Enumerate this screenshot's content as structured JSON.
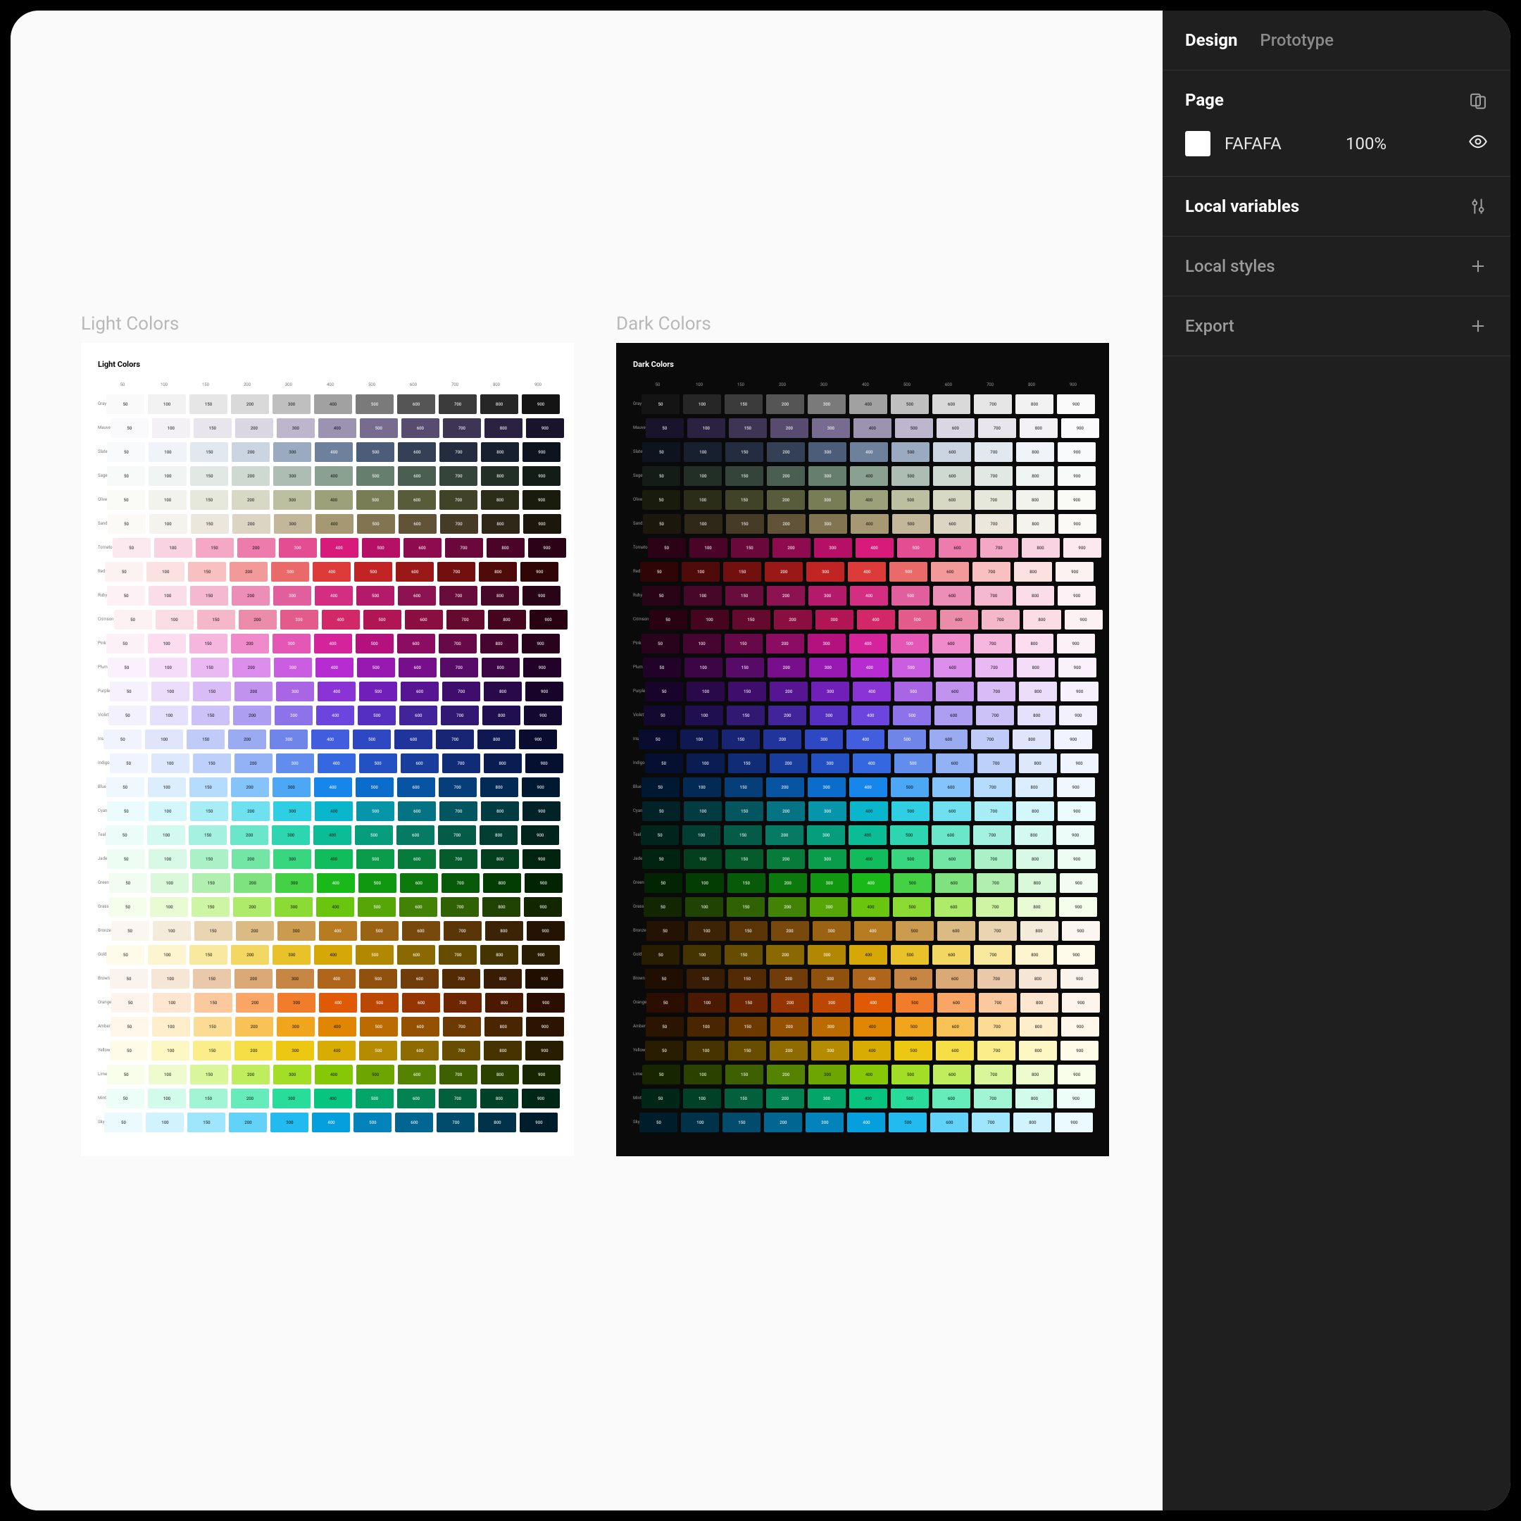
{
  "tabs": {
    "design": "Design",
    "prototype": "Prototype"
  },
  "page": {
    "label": "Page",
    "fill_hex": "FAFAFA",
    "fill_opacity": "100%"
  },
  "sections": {
    "local_variables": "Local variables",
    "local_styles": "Local styles",
    "export": "Export"
  },
  "canvas": {
    "light_frame_label": "Light Colors",
    "dark_frame_label": "Dark Colors",
    "light_title": "Light Colors",
    "dark_title": "Dark Colors",
    "steps": [
      "50",
      "100",
      "150",
      "200",
      "300",
      "400",
      "500",
      "600",
      "700",
      "800",
      "900"
    ],
    "families": [
      {
        "name": "Gray",
        "colors": [
          "#FAFAFA",
          "#F2F2F2",
          "#E6E6E6",
          "#D9D9D9",
          "#BFBFBF",
          "#A1A1A1",
          "#7A7A7A",
          "#555555",
          "#3B3B3B",
          "#262626",
          "#141414"
        ]
      },
      {
        "name": "Mauve",
        "colors": [
          "#FAF9FB",
          "#F3F1F6",
          "#E8E5ED",
          "#DAD6E3",
          "#BDB6CC",
          "#9C93B1",
          "#776C90",
          "#574C70",
          "#3E3554",
          "#2A2240",
          "#19132B"
        ]
      },
      {
        "name": "Slate",
        "colors": [
          "#F8FAFC",
          "#F0F4F8",
          "#E2E8F0",
          "#CBD5E1",
          "#9AAAC0",
          "#6E819C",
          "#4B5D78",
          "#334056",
          "#232D3F",
          "#17202E",
          "#0D1420"
        ]
      },
      {
        "name": "Sage",
        "colors": [
          "#F8FAF9",
          "#F0F4F2",
          "#E2E9E5",
          "#CED9D2",
          "#AEBDB3",
          "#8AA091",
          "#667E6E",
          "#4A5E51",
          "#34443A",
          "#222F27",
          "#131C17"
        ]
      },
      {
        "name": "Olive",
        "colors": [
          "#FAFAF7",
          "#F3F3ED",
          "#E7E8DC",
          "#D7D9C5",
          "#BCC0A1",
          "#9CA17A",
          "#787D56",
          "#585C3B",
          "#404328",
          "#2B2D19",
          "#191B0D"
        ]
      },
      {
        "name": "Sand",
        "colors": [
          "#FBFAF7",
          "#F5F3ED",
          "#EBE7DC",
          "#DCD5C4",
          "#C2B79B",
          "#A69872",
          "#827450",
          "#605338",
          "#463B26",
          "#2F2718",
          "#1C170C"
        ]
      },
      {
        "name": "Tomato",
        "colors": [
          "#FCE9EF",
          "#F9D3E1",
          "#F4A8C6",
          "#ED7BAB",
          "#E44D92",
          "#D81B7A",
          "#B51066",
          "#8F0B50",
          "#6A073B",
          "#490428",
          "#2C0217"
        ]
      },
      {
        "name": "Red",
        "colors": [
          "#FDF2F2",
          "#FCE1E1",
          "#F8C0C0",
          "#F29A9A",
          "#EA6A6A",
          "#DD3A3A",
          "#C22323",
          "#9A1818",
          "#721010",
          "#4F0A0A",
          "#2F0505"
        ]
      },
      {
        "name": "Ruby",
        "colors": [
          "#FDF1F5",
          "#FADDE8",
          "#F4B9D1",
          "#EC8EB7",
          "#E25F9D",
          "#D32E82",
          "#B31A69",
          "#8D1252",
          "#680C3C",
          "#470728",
          "#290416"
        ]
      },
      {
        "name": "Crimson",
        "colors": [
          "#FDF1F4",
          "#FADDE5",
          "#F4B8CA",
          "#EC8CAB",
          "#E25B8A",
          "#D22868",
          "#B21553",
          "#8B0E40",
          "#66092E",
          "#45051E",
          "#280211"
        ]
      },
      {
        "name": "Pink",
        "colors": [
          "#FDF1F8",
          "#FBDDEF",
          "#F6B7DE",
          "#EF8ACB",
          "#E557B4",
          "#D5249B",
          "#B4117F",
          "#8D0C63",
          "#670848",
          "#460430",
          "#29021B"
        ]
      },
      {
        "name": "Plum",
        "colors": [
          "#FBF1FD",
          "#F5DDFA",
          "#EAB9F4",
          "#DC8EEC",
          "#CB5DE1",
          "#B62CD1",
          "#9818B2",
          "#770F8C",
          "#570A67",
          "#3B0546",
          "#220229"
        ]
      },
      {
        "name": "Purple",
        "colors": [
          "#F7F1FD",
          "#ECDDFA",
          "#D9BBF5",
          "#C293EE",
          "#A865E4",
          "#8B34D6",
          "#7020B8",
          "#561592",
          "#3F0E6C",
          "#2A094A",
          "#18042B"
        ]
      },
      {
        "name": "Violet",
        "colors": [
          "#F3F1FE",
          "#E5E0FC",
          "#CCC2F8",
          "#AE9EF2",
          "#8D73EA",
          "#6B45DD",
          "#5530C0",
          "#41239A",
          "#301873",
          "#200F50",
          "#120830"
        ]
      },
      {
        "name": "Iris",
        "colors": [
          "#F1F3FE",
          "#E0E5FC",
          "#C1CBF8",
          "#9BABF2",
          "#6F85EA",
          "#425EDE",
          "#2E47C2",
          "#21349B",
          "#172574",
          "#0F1850",
          "#080D30"
        ]
      },
      {
        "name": "Indigo",
        "colors": [
          "#F0F4FE",
          "#DEE8FD",
          "#BDD0FA",
          "#93B2F5",
          "#628DED",
          "#3567E0",
          "#2351C4",
          "#183D9D",
          "#102C76",
          "#0A1D52",
          "#051031"
        ]
      },
      {
        "name": "Blue",
        "colors": [
          "#EFF7FF",
          "#DBEEFE",
          "#B6DCFD",
          "#84C4FA",
          "#4CA7F5",
          "#1786EA",
          "#0A6CCB",
          "#0754A2",
          "#053E79",
          "#032A54",
          "#011832"
        ]
      },
      {
        "name": "Cyan",
        "colors": [
          "#ECFCFE",
          "#D4F7FB",
          "#A7EDF6",
          "#6EE0EF",
          "#2FCEE2",
          "#0AB6CB",
          "#0695A9",
          "#047485",
          "#035660",
          "#023B42",
          "#012226"
        ]
      },
      {
        "name": "Teal",
        "colors": [
          "#ECFDF9",
          "#D3F9F0",
          "#A4F1DF",
          "#6AE6CA",
          "#2DD6B0",
          "#0ABD96",
          "#069D7D",
          "#047B62",
          "#035B48",
          "#023E31",
          "#01241C"
        ]
      },
      {
        "name": "Jade",
        "colors": [
          "#EEFDF4",
          "#D7F9E5",
          "#AAF1C8",
          "#73E6A5",
          "#38D67F",
          "#10BC5C",
          "#0A9C4B",
          "#077B3A",
          "#055B2B",
          "#033E1D",
          "#012410"
        ]
      },
      {
        "name": "Green",
        "colors": [
          "#F0FDF0",
          "#DAF8DA",
          "#B1EFB1",
          "#7EE27E",
          "#45D145",
          "#1AB91A",
          "#109910",
          "#0B790B",
          "#075A07",
          "#043D04",
          "#022402"
        ]
      },
      {
        "name": "Grass",
        "colors": [
          "#F5FEEB",
          "#E8FBD2",
          "#CEF5A3",
          "#AEEB6B",
          "#8ADC34",
          "#6AC50F",
          "#56A608",
          "#428305",
          "#306103",
          "#204202",
          "#122601"
        ]
      },
      {
        "name": "Bronze",
        "colors": [
          "#FBF6EF",
          "#F5EBDB",
          "#EAD5B3",
          "#DCBA83",
          "#CB9B50",
          "#B77B22",
          "#996313",
          "#78490C",
          "#593508",
          "#3D2305",
          "#241302"
        ]
      },
      {
        "name": "Gold",
        "colors": [
          "#FEFBEB",
          "#FCF5D0",
          "#F8E99E",
          "#F2D863",
          "#E9C22A",
          "#D5A707",
          "#B28803",
          "#8B6902",
          "#664C01",
          "#453301",
          "#281D00"
        ]
      },
      {
        "name": "Brown",
        "colors": [
          "#FBF4ED",
          "#F5E6D6",
          "#E9C9A9",
          "#DAA976",
          "#C78644",
          "#AF651A",
          "#90500E",
          "#703C09",
          "#522B05",
          "#381C03",
          "#200F01"
        ]
      },
      {
        "name": "Orange",
        "colors": [
          "#FFF4EB",
          "#FEE6D1",
          "#FCC99F",
          "#F8A565",
          "#F17D2C",
          "#E05A06",
          "#BC4703",
          "#943502",
          "#6D2601",
          "#4A1900",
          "#2B0E00"
        ]
      },
      {
        "name": "Amber",
        "colors": [
          "#FFF8EA",
          "#FEEECC",
          "#FCDB95",
          "#F8C256",
          "#F1A51C",
          "#E08603",
          "#BC6B01",
          "#935101",
          "#6C3A00",
          "#492600",
          "#2B1500"
        ]
      },
      {
        "name": "Yellow",
        "colors": [
          "#FEFCE8",
          "#FDF7C4",
          "#FBED89",
          "#F6DE47",
          "#EDC812",
          "#D8AC02",
          "#B58C01",
          "#8E6B01",
          "#684D00",
          "#473300",
          "#291D00"
        ]
      },
      {
        "name": "Lime",
        "colors": [
          "#F8FEEA",
          "#EEFBCE",
          "#DAF69A",
          "#C0ED5E",
          "#A2DE25",
          "#86C706",
          "#6DA603",
          "#548302",
          "#3E6001",
          "#2A4100",
          "#182600"
        ]
      },
      {
        "name": "Mint",
        "colors": [
          "#ECFEF7",
          "#D2FBEB",
          "#A1F5D5",
          "#66ECBA",
          "#28DD9A",
          "#07C57E",
          "#04A568",
          "#038252",
          "#02603C",
          "#014128",
          "#002617"
        ]
      },
      {
        "name": "Sky",
        "colors": [
          "#EBFAFF",
          "#D1F3FE",
          "#9FE5FC",
          "#63D2F8",
          "#23BAF0",
          "#059FDD",
          "#0383BA",
          "#026693",
          "#014B6C",
          "#00324A",
          "#001D2C"
        ]
      }
    ]
  }
}
